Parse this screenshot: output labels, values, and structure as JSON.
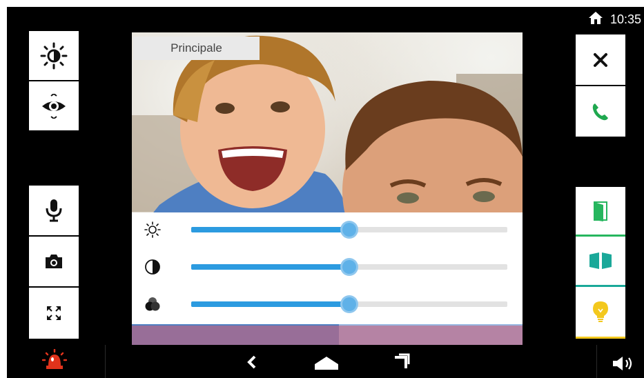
{
  "status_bar": {
    "time": "10:35",
    "home_icon": "home-icon"
  },
  "video": {
    "label": "Principale"
  },
  "left_buttons": [
    {
      "icon": "brightness-icon"
    },
    {
      "icon": "view-eye-icon"
    },
    {
      "icon": "microphone-icon"
    },
    {
      "icon": "camera-icon"
    },
    {
      "icon": "fullscreen-icon"
    }
  ],
  "right_buttons": [
    {
      "icon": "close-icon"
    },
    {
      "icon": "call-answer-icon"
    },
    {
      "icon": "door-open-icon"
    },
    {
      "icon": "gate-open-icon"
    },
    {
      "icon": "light-bulb-icon"
    }
  ],
  "sliders": [
    {
      "name": "brightness",
      "icon": "sun-icon",
      "level": 0.5
    },
    {
      "name": "contrast",
      "icon": "contrast-icon",
      "level": 0.5
    },
    {
      "name": "color",
      "icon": "color-saturation-icon",
      "level": 0.5
    }
  ],
  "bottom_bar": {
    "left_icon": "alarm-siren-icon",
    "nav": [
      "back-icon",
      "home-nav-icon",
      "recent-apps-icon"
    ],
    "right_icon": "volume-icon"
  },
  "colors": {
    "accent_blue": "#2c9be0",
    "call_green": "#1fa84f",
    "door_green": "#26b65e",
    "bulb_yellow": "#f3c81d",
    "alarm_red": "#e0331c"
  }
}
